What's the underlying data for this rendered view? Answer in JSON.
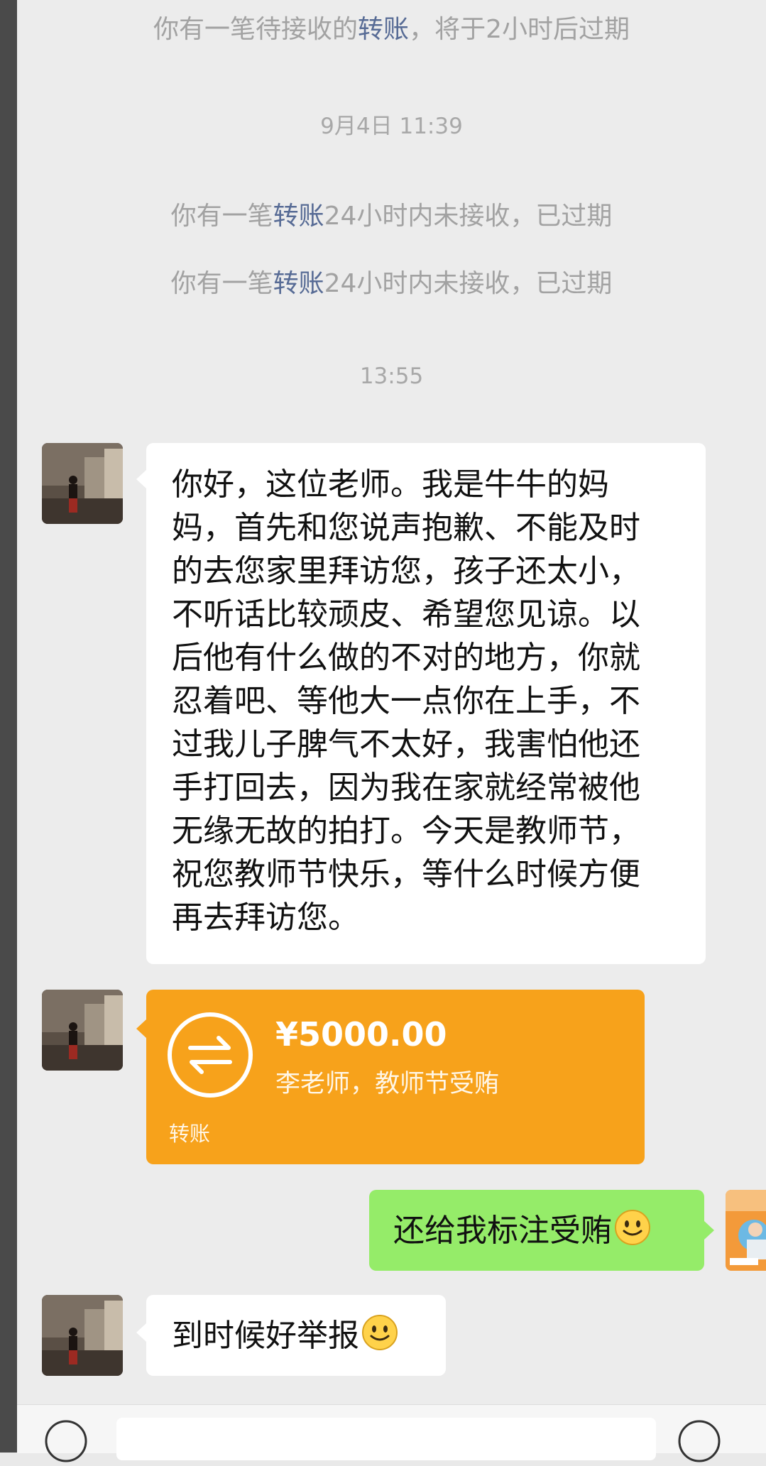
{
  "system_messages": {
    "pending_transfer": {
      "prefix": "你有一笔待接收的",
      "link": "转账",
      "suffix": "，将于2小时后过期"
    },
    "expired_1": {
      "prefix": "你有一笔",
      "link": "转账",
      "suffix": "24小时内未接收，已过期"
    },
    "expired_2": {
      "prefix": "你有一笔",
      "link": "转账",
      "suffix": "24小时内未接收，已过期"
    }
  },
  "timestamps": {
    "t1": "9月4日 11:39",
    "t2": "13:55"
  },
  "messages": {
    "long_message_lines": [
      "你好，这位老师。我是牛牛的妈",
      "妈，首先和您说声抱歉、不能及时",
      "的去您家里拜访您，孩子还太小，",
      "不听话比较顽皮、希望您见谅。以",
      "后他有什么做的不对的地方，你就",
      "忍着吧、等他大一点你在上手，不",
      "过我儿子脾气不太好，我害怕他还",
      "手打回去，因为我在家就经常被他",
      "无缘无故的拍打。今天是教师节，",
      "祝您教师节快乐，等什么时候方便",
      "再去拜访您。"
    ],
    "transfer": {
      "amount": "¥5000.00",
      "note": "李老师，教师节受贿",
      "label": "转账",
      "icon": "transfer-arrows-icon"
    },
    "reply_self": "还给我标注受贿",
    "reply_other": "到时候好举报"
  },
  "icons": {
    "emoji": "smile-emoji-icon",
    "voice": "voice-icon",
    "emoji_button": "emoji-button-icon"
  },
  "colors": {
    "link": "#576b95",
    "self_bubble": "#95ec69",
    "transfer_bubble": "#f7a21b",
    "background": "#ececec"
  }
}
